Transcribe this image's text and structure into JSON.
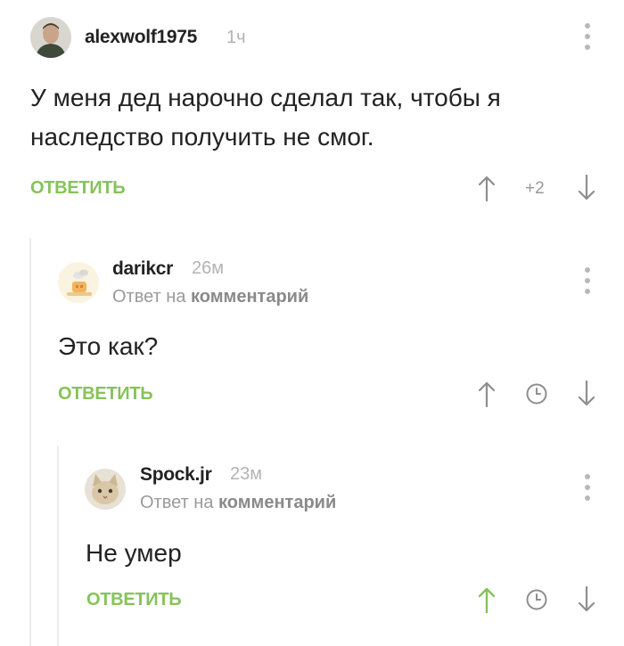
{
  "comments": [
    {
      "author": "alexwolf1975",
      "time": "1ч",
      "text_lines": [
        "У меня дед нарочно сделал так, чтобы я",
        "наследство получить не смог."
      ],
      "reply_label": "ОТВЕТИТЬ",
      "rating": "+2",
      "icons": [
        "up-arrow-icon",
        "down-arrow-icon",
        "more-vertical-icon"
      ]
    },
    {
      "author": "darikcr",
      "time": "26м",
      "reply_to_prefix": "Ответ на",
      "reply_to_target": "комментарий",
      "text": "Это как?",
      "reply_label": "ОТВЕТИТЬ",
      "icons": [
        "up-arrow-icon",
        "clock-icon",
        "down-arrow-icon",
        "more-vertical-icon"
      ]
    },
    {
      "author": "Spock.jr",
      "time": "23м",
      "reply_to_prefix": "Ответ на",
      "reply_to_target": "комментарий",
      "text": "Не умер",
      "reply_label": "ОТВЕТИТЬ",
      "upvoted": true,
      "icons": [
        "up-arrow-icon",
        "clock-icon",
        "down-arrow-icon",
        "more-vertical-icon"
      ]
    }
  ],
  "colors": {
    "accent_green": "#86c35a",
    "meta_gray": "#b3b3b3",
    "icon_gray": "#8e8e8e",
    "thread_line": "#ececec"
  }
}
